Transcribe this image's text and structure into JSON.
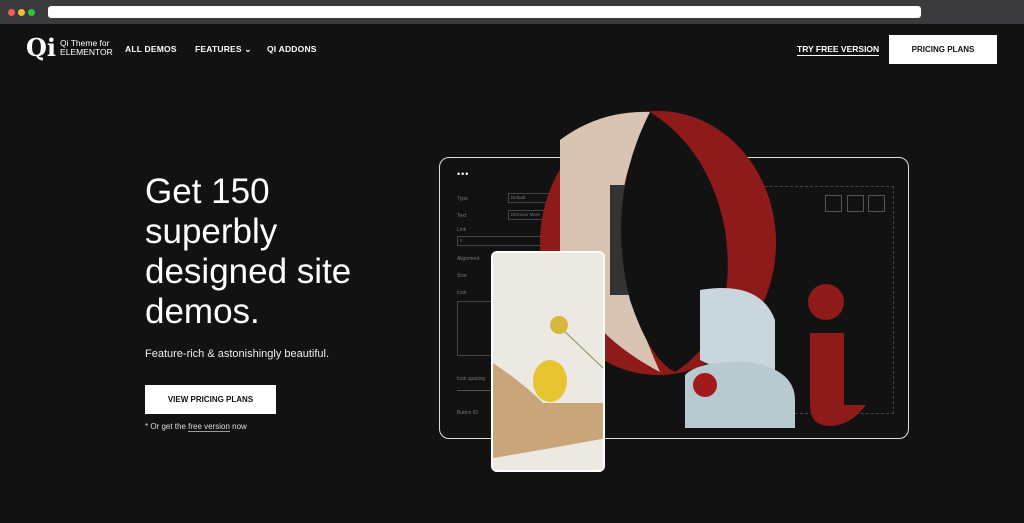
{
  "nav": {
    "logo_line1": "Qi Theme for",
    "logo_line2": "ELEMENTOR",
    "logo_mark": "Qi",
    "items": [
      "ALL DEMOS",
      "FEATURES",
      "QI ADDONS"
    ],
    "try_free": "TRY FREE VERSION",
    "pricing": "PRICING PLANS"
  },
  "hero": {
    "headline": "Get 150 superbly designed site demos.",
    "subtitle": "Feature-rich & astonishingly beautiful.",
    "cta": "VIEW PRICING PLANS",
    "note_prefix": "* Or get the ",
    "note_link": "free version",
    "note_suffix": " now"
  },
  "editor": {
    "labels": [
      "Type",
      "Text",
      "Link",
      "Alignment",
      "Size",
      "Icon",
      "Icon spacing",
      "Button ID"
    ],
    "type_value": "Default",
    "text_value": "Discover More",
    "link_value": "#"
  },
  "colors": {
    "accent": "#8e1b1a",
    "background": "#121212"
  }
}
